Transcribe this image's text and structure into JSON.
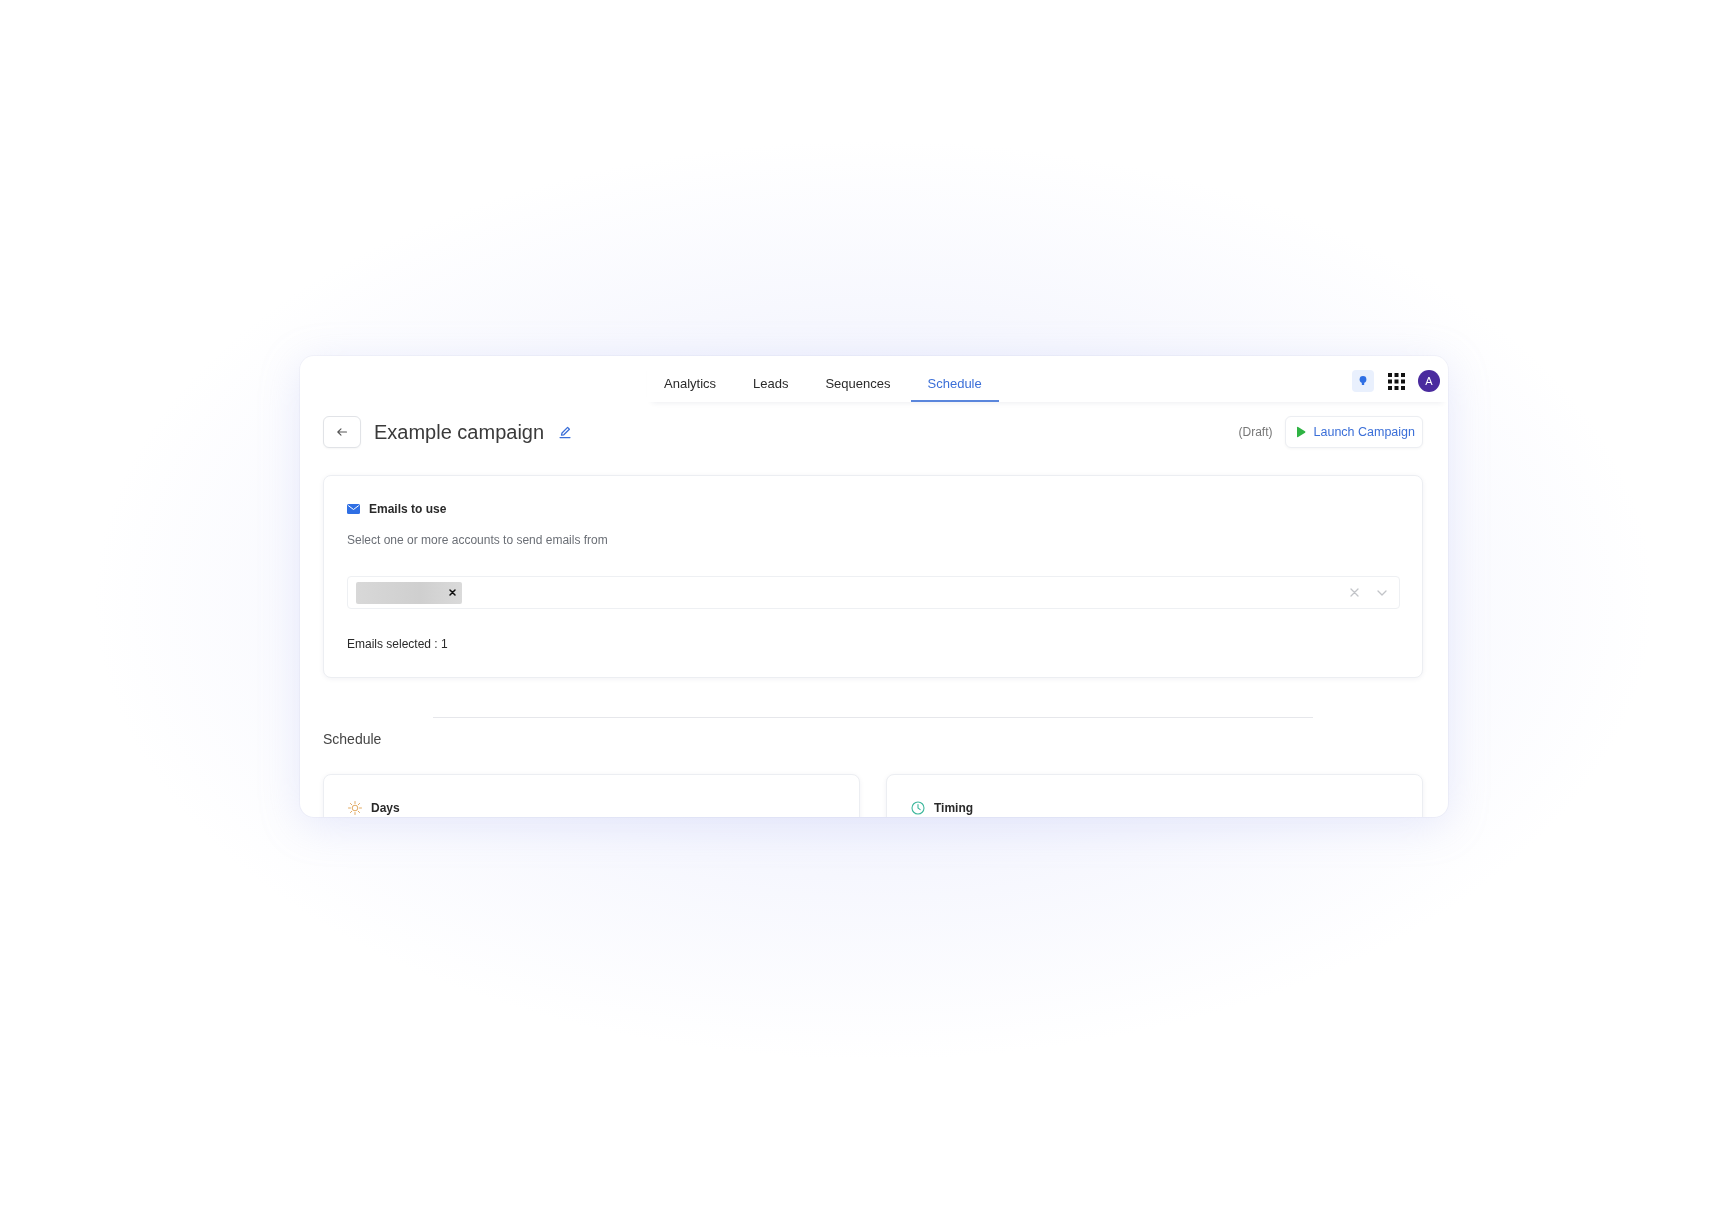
{
  "nav": {
    "tabs": [
      {
        "label": "Analytics",
        "selected": false
      },
      {
        "label": "Leads",
        "selected": false
      },
      {
        "label": "Sequences",
        "selected": false
      },
      {
        "label": "Schedule",
        "selected": true
      }
    ],
    "avatar": {
      "initial": "A"
    }
  },
  "header": {
    "title": "Example campaign",
    "status": "(Draft)",
    "launch_button": {
      "label": "Launch Campaign"
    }
  },
  "emails_card": {
    "title": "Emails to use",
    "description": "Select one or more accounts to send emails from",
    "account_select": {
      "chips": [
        {
          "kind": "redacted"
        }
      ]
    },
    "selected_count": "Emails selected : 1"
  },
  "schedule": {
    "heading": "Schedule",
    "cards": [
      {
        "kind": "days",
        "title": "Days"
      },
      {
        "kind": "timing",
        "title": "Timing"
      }
    ]
  }
}
